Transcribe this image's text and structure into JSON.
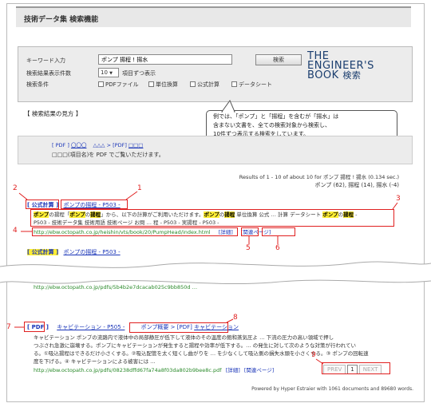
{
  "header": {
    "title": "技術データ集 検索機能"
  },
  "search": {
    "keyword_label": "キーワード入力",
    "keyword_value": "ポンプ 揚程 ! 揚水",
    "search_button": "検索",
    "count_label": "検索結果表示件数",
    "count_value": "10",
    "count_suffix": "項目ずつ表示",
    "conditions_label": "検索条件",
    "conditions": [
      "PDFファイル",
      "単位換算",
      "公式計算",
      "データシート"
    ]
  },
  "logo": {
    "line1": "THE",
    "line2": "ENGINEER'S",
    "line3": "BOOK",
    "line3b": "検索"
  },
  "callout": {
    "lines": [
      "例では、「ポンプ」と「揚程」を含むが「揚水」は",
      "含まない文書を、全ての検索対象から検索し、",
      "10件ずつ表示する検索をしています。"
    ]
  },
  "howto": {
    "heading": "【 検索結果の見方 】",
    "row1_pdf": "[ PDF ]",
    "row1_a": "〇〇〇",
    "row1_b": "△△△",
    "row1_arrow": ">",
    "row1_c": "[PDF]",
    "row1_d": "□□□",
    "row2": "□□□(項目名)を PDF でご覧いただけます。"
  },
  "results": {
    "summary": "Results of 1 - 10 of about 10 for ポンプ 揚程 ! 揚水 (0.134 sec.)",
    "summary2": "ポンプ (62), 揚程 (14), 揚水 (-4)",
    "item1": {
      "tag": "[ 公式計算 ]",
      "title": "ポンプの揚程 - P503 -",
      "snippet1a": "ポンプの揚程「ポンプの揚程」から、以下の計算がご利用いただけます。",
      "snippet1b": "ポンプの揚程 単位換算 公式 … 計算 データシート ポンプの揚程 -",
      "snippet2": "P503 - 技術データ集 技術用語 技術ページ お問 … 程 - P503 - 実揚程 - P503 -",
      "url": "http://ebw.octopath.co.jp/heishin/vts/book/20/PumpHead/index.html",
      "detail": "[詳細]",
      "related": "[関連ページ]"
    },
    "item2": {
      "tag": "[ 公式計算 ]",
      "title": "ポンプの揚程 - P503 -"
    },
    "item3": {
      "url_top": "http://ebw.octopath.co.jp/pdfs/5b4b2e7dcacab025c9bb850d …",
      "pdf_tag": "[ PDF ]",
      "title": "キャビテーション - P505 -",
      "crumb_a": "ポンプ概要",
      "crumb_arrow": ">",
      "crumb_b": "[PDF]",
      "crumb_c": "キャビテーション",
      "s1": "キャビテーション ポンプの流路内で液体中の局部静圧が低下して液体のその温度の飽和蒸気圧よ … 下流の圧力の高い領域で押し",
      "s2": "つぶされ急激に崩壊する。ポンプにキャビテーションが発生すると揚程や効率が低下する。… の発生に対して次のような対策が行われてい",
      "s3": "る。①吸込揚程はできるだけ小さくする。②吸込配管を太く短くし曲がりを … を少なくして吸込側の損失水頭を小さくする。③ ポンプの回転速",
      "s4": "度を下げる。④ キャビテーションによる被害には …",
      "url": "http://ebw.octopath.co.jp/pdfs/08238dffd67fa74a8f03da802b9bee8c.pdf",
      "detail": "[詳細]",
      "related": "[関連ページ]"
    }
  },
  "pager": {
    "prev": "PREV",
    "current": "1",
    "next": "NEXT"
  },
  "footer": {
    "powered": "Powered by Hyper Estraier with 1061 documents and 89680 words."
  },
  "callout_numbers": [
    "1",
    "2",
    "3",
    "4",
    "5",
    "6",
    "7",
    "8",
    "9"
  ],
  "colors": {
    "annotation": "#e02020",
    "link": "#1a35b8",
    "highlight": "#ffee33",
    "url": "#2a8a2a"
  }
}
